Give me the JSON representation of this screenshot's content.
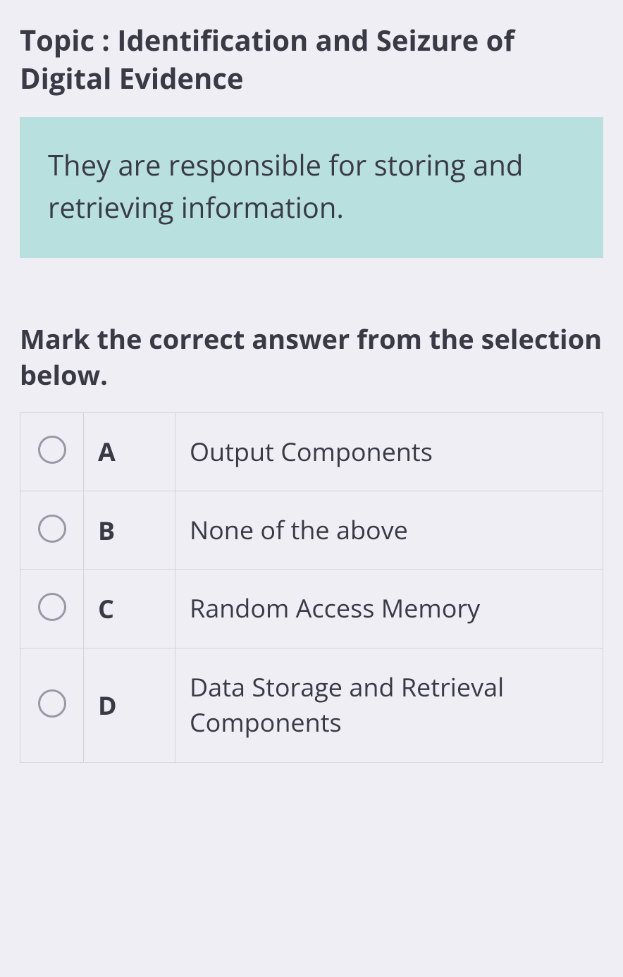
{
  "topic": "Topic : Identification and Seizure of Digital Evidence",
  "question": "They are responsible for storing and retrieving information.",
  "instruction": "Mark the correct answer from the selection below.",
  "options": [
    {
      "letter": "A",
      "text": "Output Components"
    },
    {
      "letter": "B",
      "text": "None of the above"
    },
    {
      "letter": "C",
      "text": "Random Access Memory"
    },
    {
      "letter": "D",
      "text": "Data Storage and Retrieval Components"
    }
  ]
}
